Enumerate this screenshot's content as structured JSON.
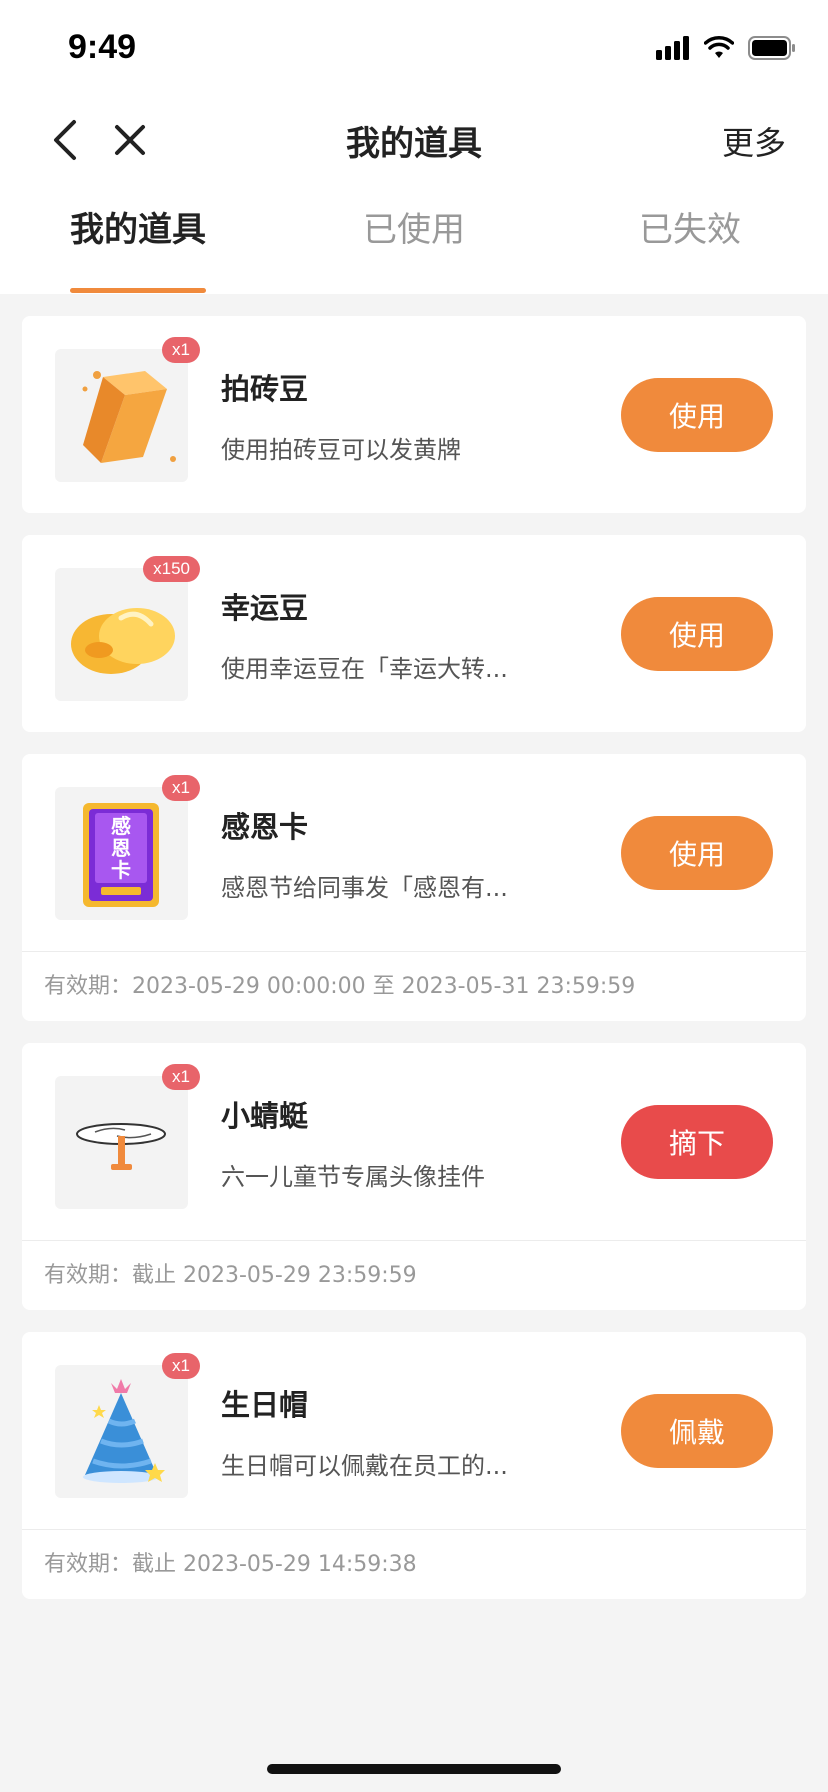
{
  "status": {
    "time": "9:49"
  },
  "nav": {
    "title": "我的道具",
    "more": "更多"
  },
  "tabs": [
    {
      "label": "我的道具",
      "active": true
    },
    {
      "label": "已使用",
      "active": false
    },
    {
      "label": "已失效",
      "active": false
    }
  ],
  "items": [
    {
      "name": "拍砖豆",
      "desc": "使用拍砖豆可以发黄牌",
      "count": "x1",
      "action": "使用",
      "validity": ""
    },
    {
      "name": "幸运豆",
      "desc": "使用幸运豆在「幸运大转...",
      "count": "x150",
      "action": "使用",
      "validity": ""
    },
    {
      "name": "感恩卡",
      "desc": "感恩节给同事发「感恩有...",
      "count": "x1",
      "action": "使用",
      "validity": "有效期：2023-05-29 00:00:00 至 2023-05-31 23:59:59",
      "card_text": "感恩卡"
    },
    {
      "name": "小蜻蜓",
      "desc": "六一儿童节专属头像挂件",
      "count": "x1",
      "action": "摘下",
      "validity": "有效期：截止 2023-05-29 23:59:59"
    },
    {
      "name": "生日帽",
      "desc": "生日帽可以佩戴在员工的...",
      "count": "x1",
      "action": "佩戴",
      "validity": "有效期：截止 2023-05-29 14:59:38"
    }
  ],
  "colors": {
    "accent": "#f08a3c",
    "danger": "#e84b4b",
    "badge": "#e8646a"
  }
}
